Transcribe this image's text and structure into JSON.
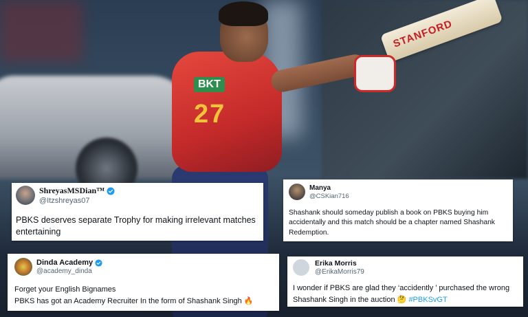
{
  "background": {
    "bat_brand": "STANFORD",
    "jersey_sponsor": "BKT",
    "jersey_number": "27"
  },
  "tweets": [
    {
      "name": "ShreyasMSDian™",
      "handle": "@Itzshreyas07",
      "verified": true,
      "text": "PBKS deserves separate Trophy for making irrelevant matches entertaining"
    },
    {
      "name": "Manya",
      "handle": "@CSKian716",
      "verified": false,
      "text": "Shashank should someday publish a book on PBKS buying him accidentally and this match should be a chapter named Shashank Redemption."
    },
    {
      "name": "Dinda Academy",
      "handle": "@academy_dinda",
      "verified": true,
      "line1": "Forget your English Bignames",
      "line2": "PBKS has got an Academy Recruiter In the form of Shashank Singh",
      "emoji": "🔥"
    },
    {
      "name": "Erika Morris",
      "handle": "@ErikaMorris79",
      "verified": false,
      "text": "I wonder if PBKS are glad they ‘accidently ’ purchased the wrong Shashank Singh in the auction",
      "emoji": "🤔",
      "hashtag": "#PBKSvGT"
    }
  ],
  "colors": {
    "verified": "#1d9bf0",
    "hashtag": "#1d9bf0",
    "pbks_red": "#d62b2b"
  }
}
